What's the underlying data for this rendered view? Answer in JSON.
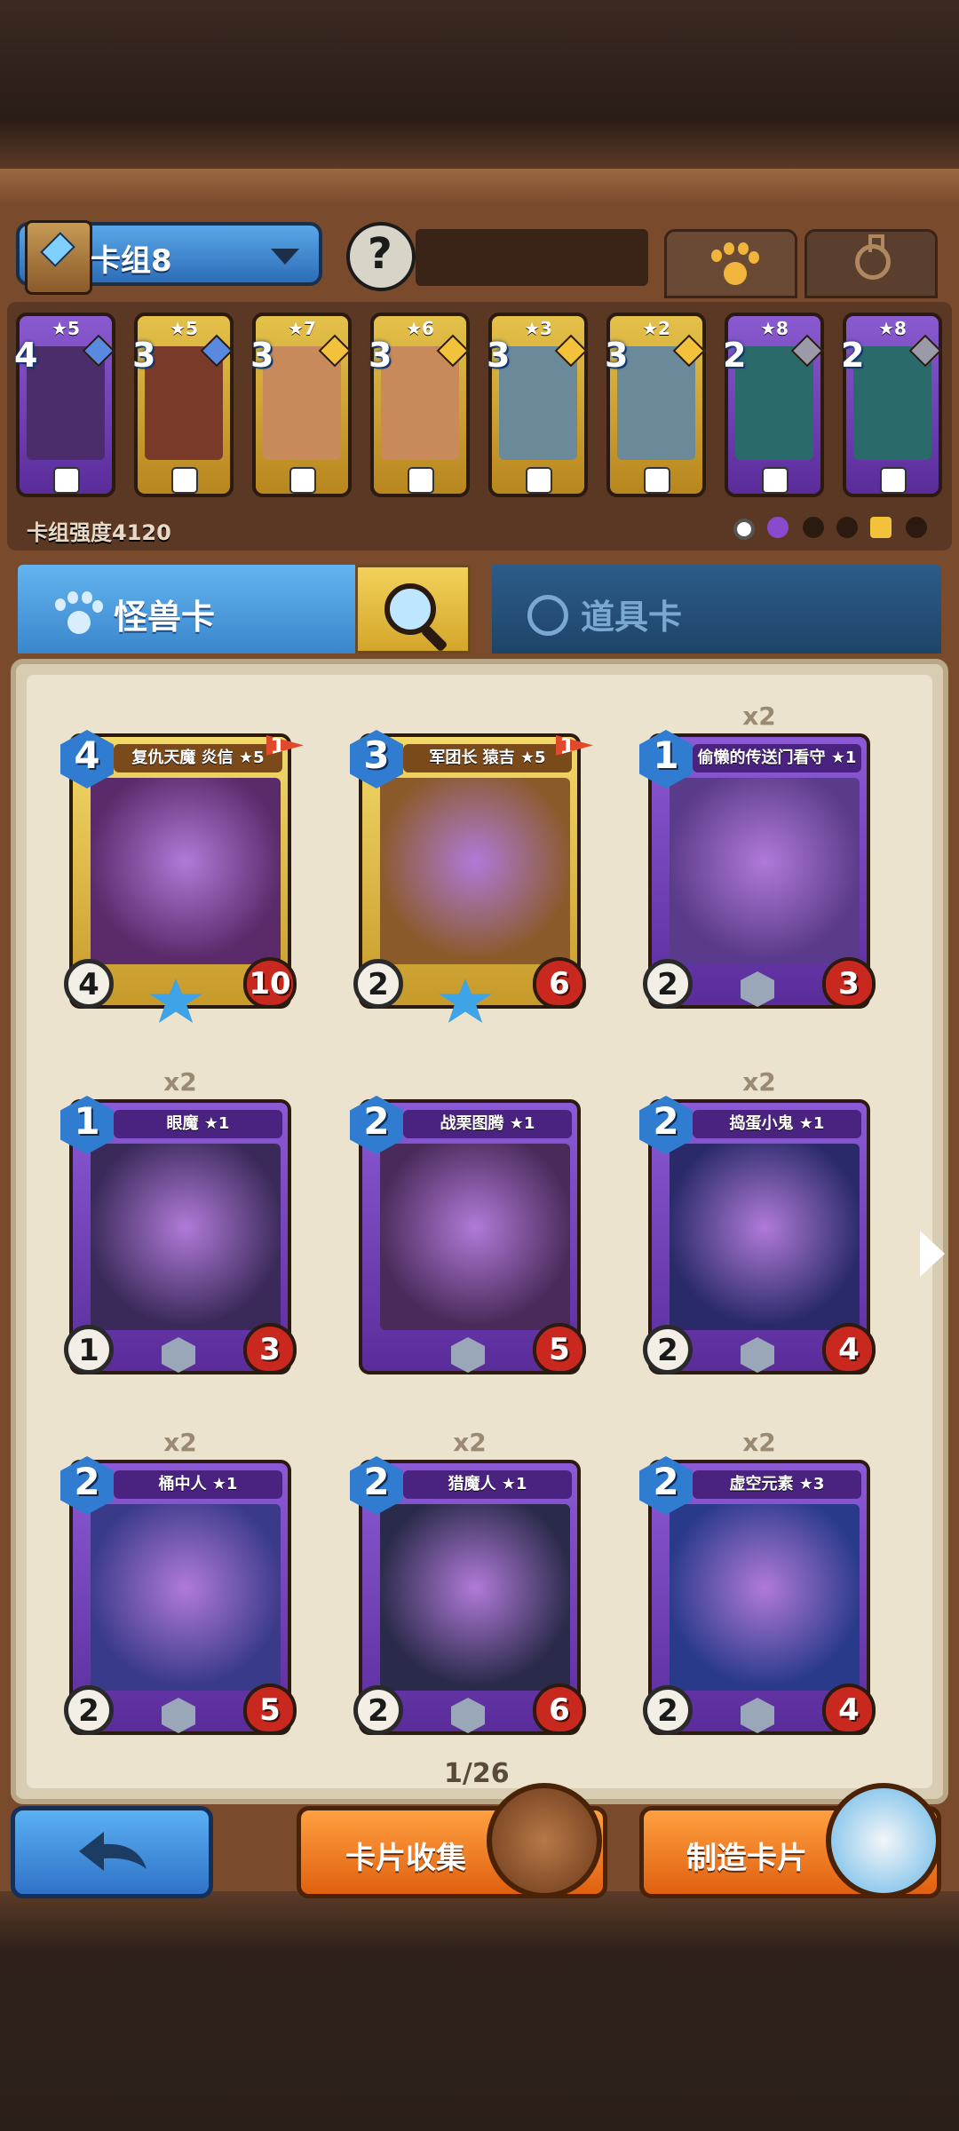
{
  "deck": {
    "name": "卡组8",
    "power_label": "卡组强度4120",
    "cards": [
      {
        "stars": "★5",
        "cost": "4",
        "frame": "purple",
        "gem": "#5a8ae0",
        "art": "#4a2d6a"
      },
      {
        "stars": "★5",
        "cost": "3",
        "frame": "gold",
        "gem": "#5a8ae0",
        "art": "#7a3a2a"
      },
      {
        "stars": "★7",
        "cost": "3",
        "frame": "gold",
        "gem": "#f2c23a",
        "art": "#c88a5a"
      },
      {
        "stars": "★6",
        "cost": "3",
        "frame": "gold",
        "gem": "#f2c23a",
        "art": "#c88a5a"
      },
      {
        "stars": "★3",
        "cost": "3",
        "frame": "gold",
        "gem": "#f2c23a",
        "art": "#6a8a9a"
      },
      {
        "stars": "★2",
        "cost": "3",
        "frame": "gold",
        "gem": "#f2c23a",
        "art": "#6a8a9a"
      },
      {
        "stars": "★8",
        "cost": "2",
        "frame": "purple",
        "gem": "#9a9aa8",
        "art": "#2a6a6a"
      },
      {
        "stars": "★8",
        "cost": "2",
        "frame": "purple",
        "gem": "#9a9aa8",
        "art": "#2a6a6a"
      }
    ]
  },
  "tabs": {
    "monster": "怪兽卡",
    "item": "道具卡"
  },
  "collection": {
    "page": "1/26",
    "cards": [
      {
        "name": "复仇天魔 炎信 ★5",
        "copies": "",
        "cost": "4",
        "atk": "4",
        "hp": "10",
        "frame": "gold",
        "flag": "1",
        "art": "#5a2a6a"
      },
      {
        "name": "军团长 猿吉 ★5",
        "copies": "",
        "cost": "3",
        "atk": "2",
        "hp": "6",
        "frame": "gold",
        "flag": "1",
        "art": "#8a5a2a"
      },
      {
        "name": "偷懒的传送门看守 ★1",
        "copies": "x2",
        "cost": "1",
        "atk": "2",
        "hp": "3",
        "frame": "purple",
        "flag": "",
        "art": "#5a3a8a"
      },
      {
        "name": "眼魔 ★1",
        "copies": "x2",
        "cost": "1",
        "atk": "1",
        "hp": "3",
        "frame": "purple",
        "flag": "",
        "art": "#3a2a5a"
      },
      {
        "name": "战栗图腾 ★1",
        "copies": "",
        "cost": "2",
        "atk": "",
        "hp": "5",
        "frame": "purple",
        "flag": "",
        "art": "#4a2a5a"
      },
      {
        "name": "捣蛋小鬼 ★1",
        "copies": "x2",
        "cost": "2",
        "atk": "2",
        "hp": "4",
        "frame": "purple",
        "flag": "",
        "art": "#2a2a6a"
      },
      {
        "name": "桶中人 ★1",
        "copies": "x2",
        "cost": "2",
        "atk": "2",
        "hp": "5",
        "frame": "purple",
        "flag": "",
        "art": "#3a3a8a"
      },
      {
        "name": "猎魔人 ★1",
        "copies": "x2",
        "cost": "2",
        "atk": "2",
        "hp": "6",
        "frame": "purple",
        "flag": "",
        "art": "#2a2a4a"
      },
      {
        "name": "虚空元素 ★3",
        "copies": "x2",
        "cost": "2",
        "atk": "2",
        "hp": "4",
        "frame": "purple",
        "flag": "",
        "art": "#2a3a8a"
      }
    ]
  },
  "buttons": {
    "back_icon": "back-arrow-icon",
    "collect": "卡片收集",
    "craft": "制造卡片"
  }
}
